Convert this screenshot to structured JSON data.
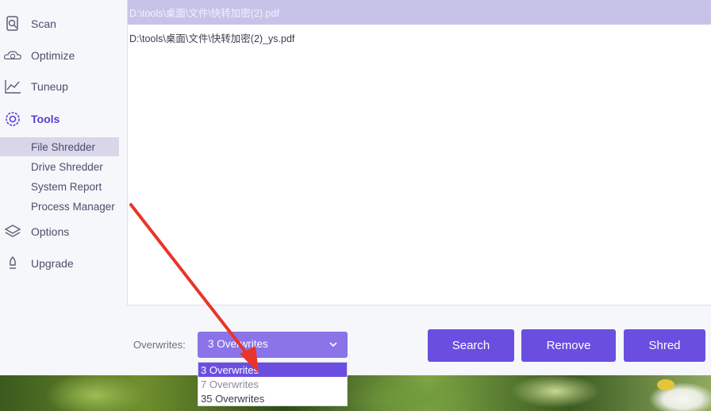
{
  "sidebar": {
    "items": [
      {
        "label": "Scan",
        "icon": "scan-icon"
      },
      {
        "label": "Optimize",
        "icon": "optimize-icon"
      },
      {
        "label": "Tuneup",
        "icon": "tuneup-icon"
      },
      {
        "label": "Tools",
        "icon": "tools-icon",
        "active": true
      },
      {
        "label": "Options",
        "icon": "options-icon"
      },
      {
        "label": "Upgrade",
        "icon": "upgrade-icon"
      }
    ],
    "tools_sub": [
      {
        "label": "File Shredder",
        "selected": true
      },
      {
        "label": "Drive Shredder"
      },
      {
        "label": "System Report"
      },
      {
        "label": "Process Manager"
      }
    ]
  },
  "file_list": {
    "rows": [
      "D:\\tools\\桌面\\文件\\快转加密(2).pdf",
      "D:\\tools\\桌面\\文件\\快转加密(2)_ys.pdf"
    ]
  },
  "overwrites": {
    "label": "Overwrites:",
    "selected": "3 Overwrites",
    "options": [
      "3 Overwrites",
      "7 Overwrites",
      "35 Overwrites"
    ]
  },
  "buttons": {
    "search": "Search",
    "remove": "Remove",
    "shred": "Shred"
  },
  "colors": {
    "accent": "#6a4ee0",
    "dropdown": "#8a74e8",
    "selected_row": "#c7c3e8",
    "annotation_arrow": "#e8352a"
  }
}
